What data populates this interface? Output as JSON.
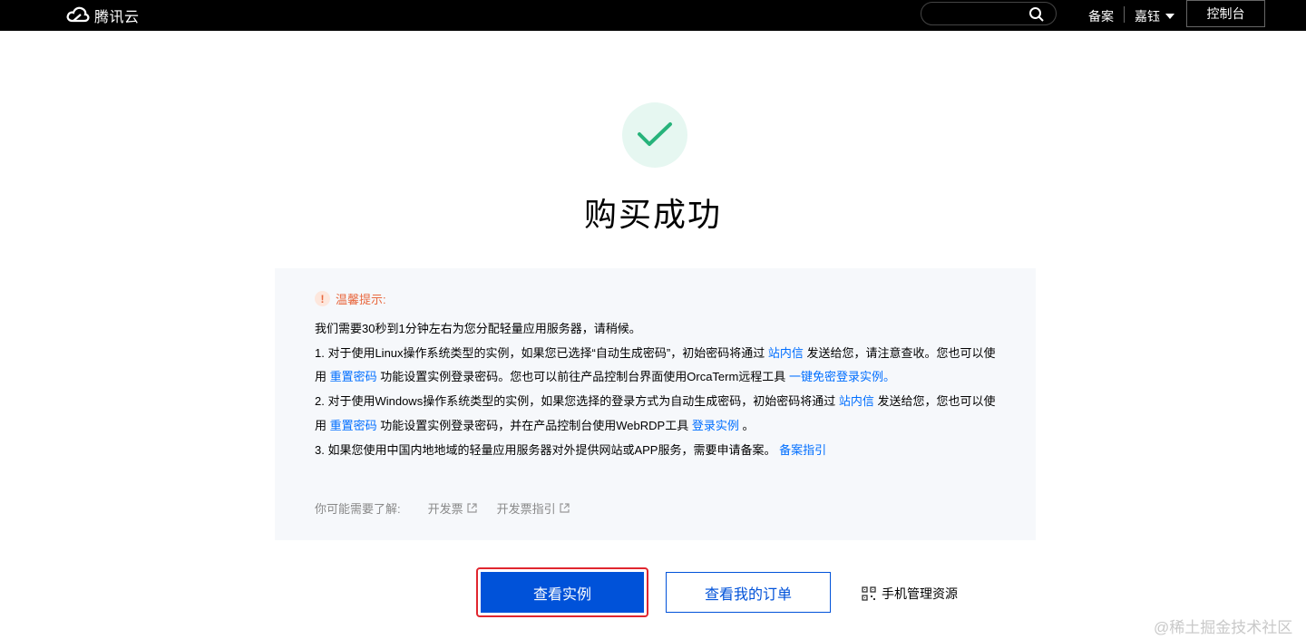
{
  "header": {
    "logo_text": "腾讯云",
    "search": {
      "value": "",
      "placeholder": ""
    },
    "nav_beian": "备案",
    "nav_user": "嘉钰",
    "console_label": "控制台"
  },
  "success": {
    "title": "购买成功",
    "accent_color": "#27b37b"
  },
  "tips": {
    "title": "温馨提示:",
    "intro": "我们需要30秒到1分钟左右为您分配轻量应用服务器，请稍候。",
    "item1": {
      "a": "1. 对于使用Linux操作系统类型的实例，如果您已选择“自动生成密码”，初始密码将通过 ",
      "link1": "站内信",
      "b": " 发送给您，请注意查收。您也可以使用 ",
      "link2": "重置密码",
      "c": " 功能设置实例登录密码。您也可以前往产品控制台界面使用OrcaTerm远程工具 ",
      "link3": "一键免密登录实例。"
    },
    "item2": {
      "a": "2. 对于使用Windows操作系统类型的实例，如果您选择的登录方式为自动生成密码，初始密码将通过 ",
      "link1": "站内信",
      "b": " 发送给您，您也可以使用 ",
      "link2": "重置密码",
      "c": " 功能设置实例登录密码，并在产品控制台使用WebRDP工具 ",
      "link3": "登录实例",
      "d": " 。"
    },
    "item3": {
      "a": "3. 如果您使用中国内地地域的轻量应用服务器对外提供网站或APP服务，需要申请备案。 ",
      "link1": "备案指引"
    },
    "more_label": "你可能需要了解:",
    "more_links": [
      "开发票",
      "开发票指引"
    ]
  },
  "actions": {
    "view_instance": "查看实例",
    "view_orders": "查看我的订单",
    "mobile_manage": "手机管理资源"
  },
  "watermark": "@稀土掘金技术社区",
  "colors": {
    "primary": "#0052d9",
    "link": "#006eff",
    "warning": "#e8683f",
    "highlight_border": "#e0262f"
  }
}
